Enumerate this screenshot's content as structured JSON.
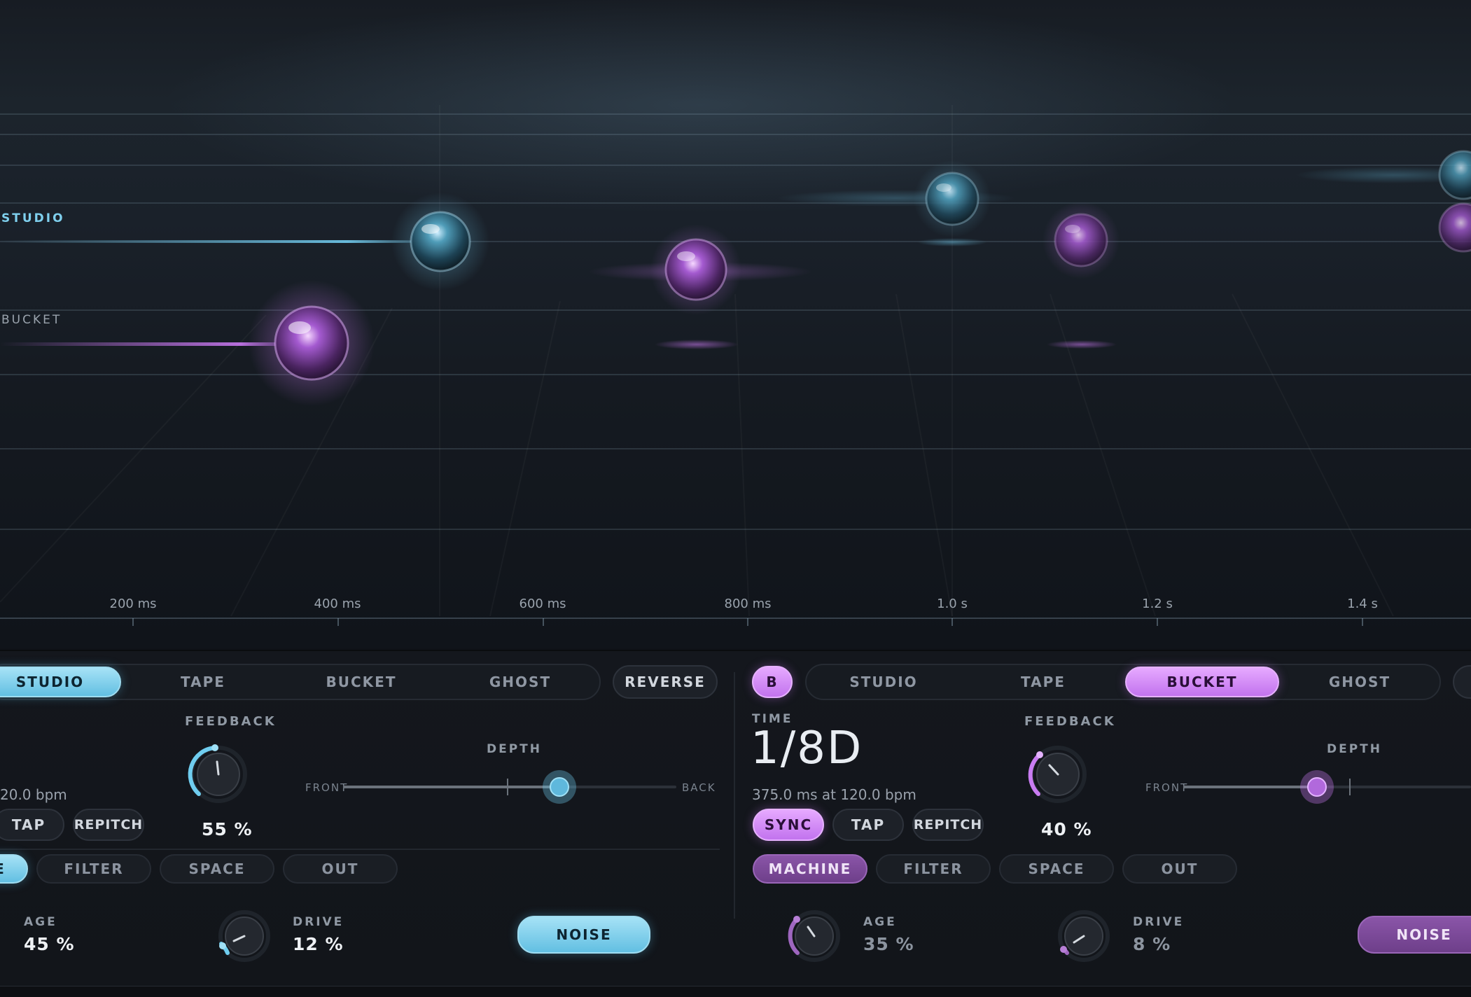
{
  "visualizer": {
    "lane_labels": {
      "studio": "STUDIO",
      "bucket": "BUCKET"
    },
    "time_axis": [
      "200 ms",
      "400 ms",
      "600 ms",
      "800 ms",
      "1.0 s",
      "1.2 s",
      "1.4 s"
    ]
  },
  "colors": {
    "accent_a": "#6cc6e6",
    "accent_b": "#c97cf2",
    "background": "#101319"
  },
  "channel_a": {
    "modes": [
      "STUDIO",
      "TAPE",
      "BUCKET",
      "GHOST"
    ],
    "selected_mode": "STUDIO",
    "reverse_label": "REVERSE",
    "bpm_text": "20.0 bpm",
    "tap_label": "TAP",
    "repitch_label": "REPITCH",
    "feedback": {
      "label": "FEEDBACK",
      "value": "55 %",
      "level": 0.55
    },
    "depth": {
      "label": "DEPTH",
      "front": "FRONT",
      "back": "BACK",
      "level": 0.65
    },
    "fx_tabs": [
      "E",
      "FILTER",
      "SPACE",
      "OUT"
    ],
    "age": {
      "label": "AGE",
      "value": "45 %"
    },
    "drive": {
      "label": "DRIVE",
      "value": "12 %",
      "level": 0.12
    },
    "noise_label": "NOISE"
  },
  "channel_b": {
    "badge": "B",
    "modes": [
      "STUDIO",
      "TAPE",
      "BUCKET",
      "GHOST"
    ],
    "selected_mode": "BUCKET",
    "time": {
      "label": "TIME",
      "value": "1/8D",
      "detail": "375.0 ms at 120.0 bpm"
    },
    "sync_label": "SYNC",
    "tap_label": "TAP",
    "repitch_label": "REPITCH",
    "feedback": {
      "label": "FEEDBACK",
      "value": "40 %",
      "level": 0.4
    },
    "depth": {
      "label": "DEPTH",
      "front": "FRONT",
      "level": 0.4
    },
    "fx_tabs": [
      "MACHINE",
      "FILTER",
      "SPACE",
      "OUT"
    ],
    "age": {
      "label": "AGE",
      "value": "35 %",
      "level": 0.35
    },
    "drive": {
      "label": "DRIVE",
      "value": "8 %",
      "level": 0.08
    },
    "noise_label": "NOISE"
  }
}
